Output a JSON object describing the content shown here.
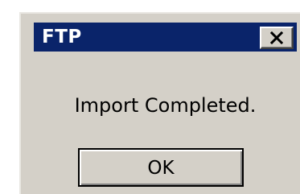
{
  "dialog": {
    "title": "FTP",
    "close_icon": "close-icon",
    "message": "Import Completed.",
    "ok_label": "OK"
  },
  "colors": {
    "titlebar": "#0a246a",
    "face": "#d4d0c8",
    "title_text": "#ffffff"
  }
}
